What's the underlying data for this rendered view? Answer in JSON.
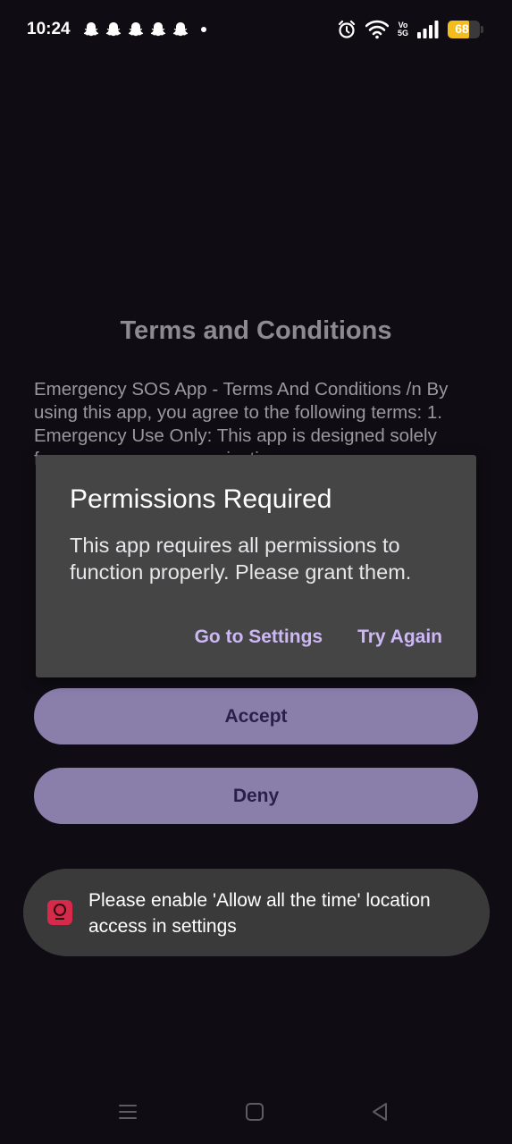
{
  "status_bar": {
    "time": "10:24",
    "battery_level": "68",
    "battery_color": "#f2bd1d",
    "notification_icons": [
      "snapchat-icon",
      "snapchat-icon",
      "snapchat-icon",
      "snapchat-icon",
      "snapchat-icon",
      "more-dot-icon"
    ],
    "system_icons": [
      "alarm-icon",
      "wifi-icon",
      "volte-icon",
      "signal-icon",
      "battery-icon"
    ],
    "volte_label_top": "Vo",
    "volte_label_bottom": "5G"
  },
  "page": {
    "title": "Terms and Conditions",
    "terms_text": "Emergency SOS App - Terms And Conditions /n  By using this app, you agree to the following terms:  1. Emergency Use Only: This app is designed solely for emergency communication",
    "accept_label": "Accept",
    "deny_label": "Deny",
    "accent_color": "#8a7fab"
  },
  "dialog": {
    "title": "Permissions Required",
    "message": "This app requires all permissions to function properly. Please grant them.",
    "settings_button": "Go to Settings",
    "retry_button": "Try Again"
  },
  "toast": {
    "message": "Please enable 'Allow all the time' location access in settings",
    "icon": "app-icon"
  },
  "nav_bar": {
    "buttons": [
      "recents-icon",
      "home-icon",
      "back-icon"
    ]
  }
}
